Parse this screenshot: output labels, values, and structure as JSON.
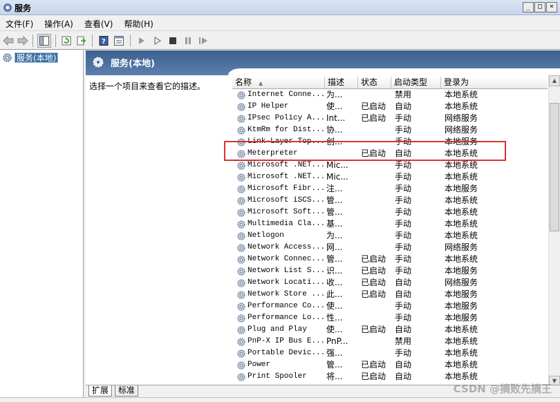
{
  "window": {
    "title": "服务",
    "minimize": "_",
    "maximize": "□",
    "close": "×"
  },
  "menu": [
    {
      "label": "文件(F)"
    },
    {
      "label": "操作(A)"
    },
    {
      "label": "查看(V)"
    },
    {
      "label": "帮助(H)"
    }
  ],
  "toolbar": {
    "help_glyph": "?"
  },
  "tree": {
    "item_label": "服务(本地)"
  },
  "panel": {
    "header_title": "服务(本地)",
    "description_prompt": "选择一个项目来查看它的描述。"
  },
  "list": {
    "columns": {
      "name": "名称",
      "desc": "描述",
      "status": "状态",
      "startup": "启动类型",
      "logon": "登录为"
    },
    "sort_indicator": "▲",
    "rows": [
      {
        "name": "Internet Conne...",
        "desc": "为...",
        "status": "",
        "startup": "禁用",
        "logon": "本地系统"
      },
      {
        "name": "IP Helper",
        "desc": "使...",
        "status": "已启动",
        "startup": "自动",
        "logon": "本地系统"
      },
      {
        "name": "IPsec Policy A...",
        "desc": "Int...",
        "status": "已启动",
        "startup": "手动",
        "logon": "网络服务"
      },
      {
        "name": "KtmRm for Dist...",
        "desc": "协...",
        "status": "",
        "startup": "手动",
        "logon": "网络服务"
      },
      {
        "name": "Link-Layer Top...",
        "desc": "创...",
        "status": "",
        "startup": "手动",
        "logon": "本地服务"
      },
      {
        "name": "Meterpreter",
        "desc": "",
        "status": "已启动",
        "startup": "自动",
        "logon": "本地系统"
      },
      {
        "name": "Microsoft .NET...",
        "desc": "Mic...",
        "status": "",
        "startup": "手动",
        "logon": "本地系统"
      },
      {
        "name": "Microsoft .NET...",
        "desc": "Mic...",
        "status": "",
        "startup": "手动",
        "logon": "本地系统"
      },
      {
        "name": "Microsoft Fibr...",
        "desc": "注...",
        "status": "",
        "startup": "手动",
        "logon": "本地服务"
      },
      {
        "name": "Microsoft iSCS...",
        "desc": "管...",
        "status": "",
        "startup": "手动",
        "logon": "本地系统"
      },
      {
        "name": "Microsoft Soft...",
        "desc": "管...",
        "status": "",
        "startup": "手动",
        "logon": "本地系统"
      },
      {
        "name": "Multimedia Cla...",
        "desc": "基...",
        "status": "",
        "startup": "手动",
        "logon": "本地系统"
      },
      {
        "name": "Netlogon",
        "desc": "为...",
        "status": "",
        "startup": "手动",
        "logon": "本地系统"
      },
      {
        "name": "Network Access...",
        "desc": "网...",
        "status": "",
        "startup": "手动",
        "logon": "网络服务"
      },
      {
        "name": "Network Connec...",
        "desc": "管...",
        "status": "已启动",
        "startup": "手动",
        "logon": "本地系统"
      },
      {
        "name": "Network List S...",
        "desc": "识...",
        "status": "已启动",
        "startup": "手动",
        "logon": "本地服务"
      },
      {
        "name": "Network Locati...",
        "desc": "收...",
        "status": "已启动",
        "startup": "自动",
        "logon": "网络服务"
      },
      {
        "name": "Network Store ...",
        "desc": "此...",
        "status": "已启动",
        "startup": "自动",
        "logon": "本地服务"
      },
      {
        "name": "Performance Co...",
        "desc": "使...",
        "status": "",
        "startup": "手动",
        "logon": "本地服务"
      },
      {
        "name": "Performance Lo...",
        "desc": "性...",
        "status": "",
        "startup": "手动",
        "logon": "本地服务"
      },
      {
        "name": "Plug and Play",
        "desc": "使...",
        "status": "已启动",
        "startup": "自动",
        "logon": "本地系统"
      },
      {
        "name": "PnP-X IP Bus E...",
        "desc": "PnP...",
        "status": "",
        "startup": "禁用",
        "logon": "本地系统"
      },
      {
        "name": "Portable Devic...",
        "desc": "强...",
        "status": "",
        "startup": "手动",
        "logon": "本地系统"
      },
      {
        "name": "Power",
        "desc": "管...",
        "status": "已启动",
        "startup": "自动",
        "logon": "本地系统"
      },
      {
        "name": "Print Spooler",
        "desc": "将...",
        "status": "已启动",
        "startup": "自动",
        "logon": "本地系统"
      }
    ]
  },
  "tabs": [
    {
      "label": "扩展"
    },
    {
      "label": "标准"
    }
  ],
  "watermark": "CSDN @摘败先摘王",
  "colors": {
    "highlight": "#d9322f",
    "header": "#3b5f8e",
    "selection": "#3a6ea5"
  },
  "icons": {
    "service": "gear-icon"
  }
}
